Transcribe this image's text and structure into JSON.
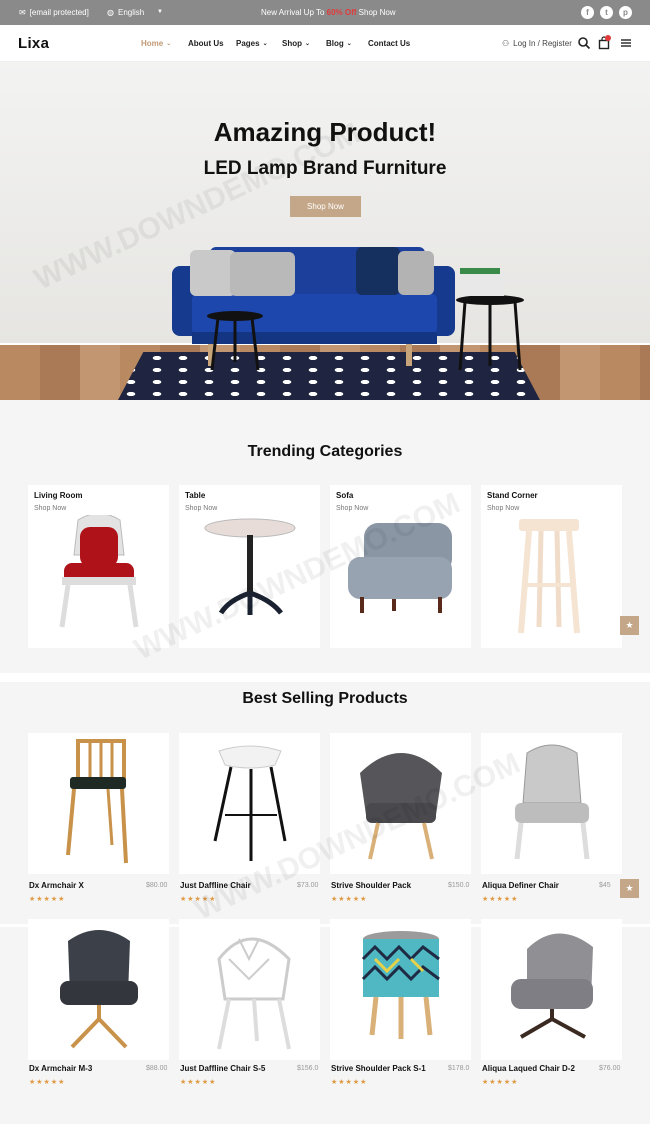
{
  "topbar": {
    "email": "[email protected]",
    "language": "English",
    "promo_prefix": "New Arrival Up To ",
    "promo_highlight": "60% Off",
    "promo_suffix": " Shop Now",
    "social": [
      "f",
      "t",
      "p"
    ]
  },
  "nav": {
    "logo": "Lixa",
    "menu": [
      "Home",
      "About Us",
      "Pages",
      "Shop",
      "Blog",
      "Contact Us"
    ],
    "active_index": 0,
    "login": "Log In / Register",
    "accent": "#c09a76"
  },
  "hero": {
    "title": "Amazing Product!",
    "subtitle": "LED Lamp Brand Furniture",
    "button": "Shop Now"
  },
  "categories": {
    "title": "Trending Categories",
    "items": [
      {
        "name": "Living Room",
        "link": "Shop Now"
      },
      {
        "name": "Table",
        "link": "Shop Now"
      },
      {
        "name": "Sofa",
        "link": "Shop Now"
      },
      {
        "name": "Stand Corner",
        "link": "Shop Now"
      }
    ]
  },
  "best": {
    "title": "Best Selling Products",
    "products": [
      {
        "name": "Dx Armchair X",
        "price": "$80.00",
        "stars": "★★★★★"
      },
      {
        "name": "Just Daffline Chair",
        "price": "$73.00",
        "stars": "★★★★★"
      },
      {
        "name": "Strive Shoulder Pack",
        "price": "$150.0",
        "stars": "★★★★★"
      },
      {
        "name": "Aliqua Definer Chair",
        "price": "$45",
        "stars": "★★★★★"
      },
      {
        "name": "Dx Armchair M-3",
        "price": "$88.00",
        "stars": "★★★★★"
      },
      {
        "name": "Just Daffline Chair S-5",
        "price": "$156.0",
        "stars": "★★★★★"
      },
      {
        "name": "Strive Shoulder Pack S-1",
        "price": "$178.0",
        "stars": "★★★★★"
      },
      {
        "name": "Aliqua Laqued Chair D-2",
        "price": "$76.00",
        "stars": "★★★★★"
      }
    ]
  },
  "watermark": "WWW.DOWNDEMO.COM"
}
